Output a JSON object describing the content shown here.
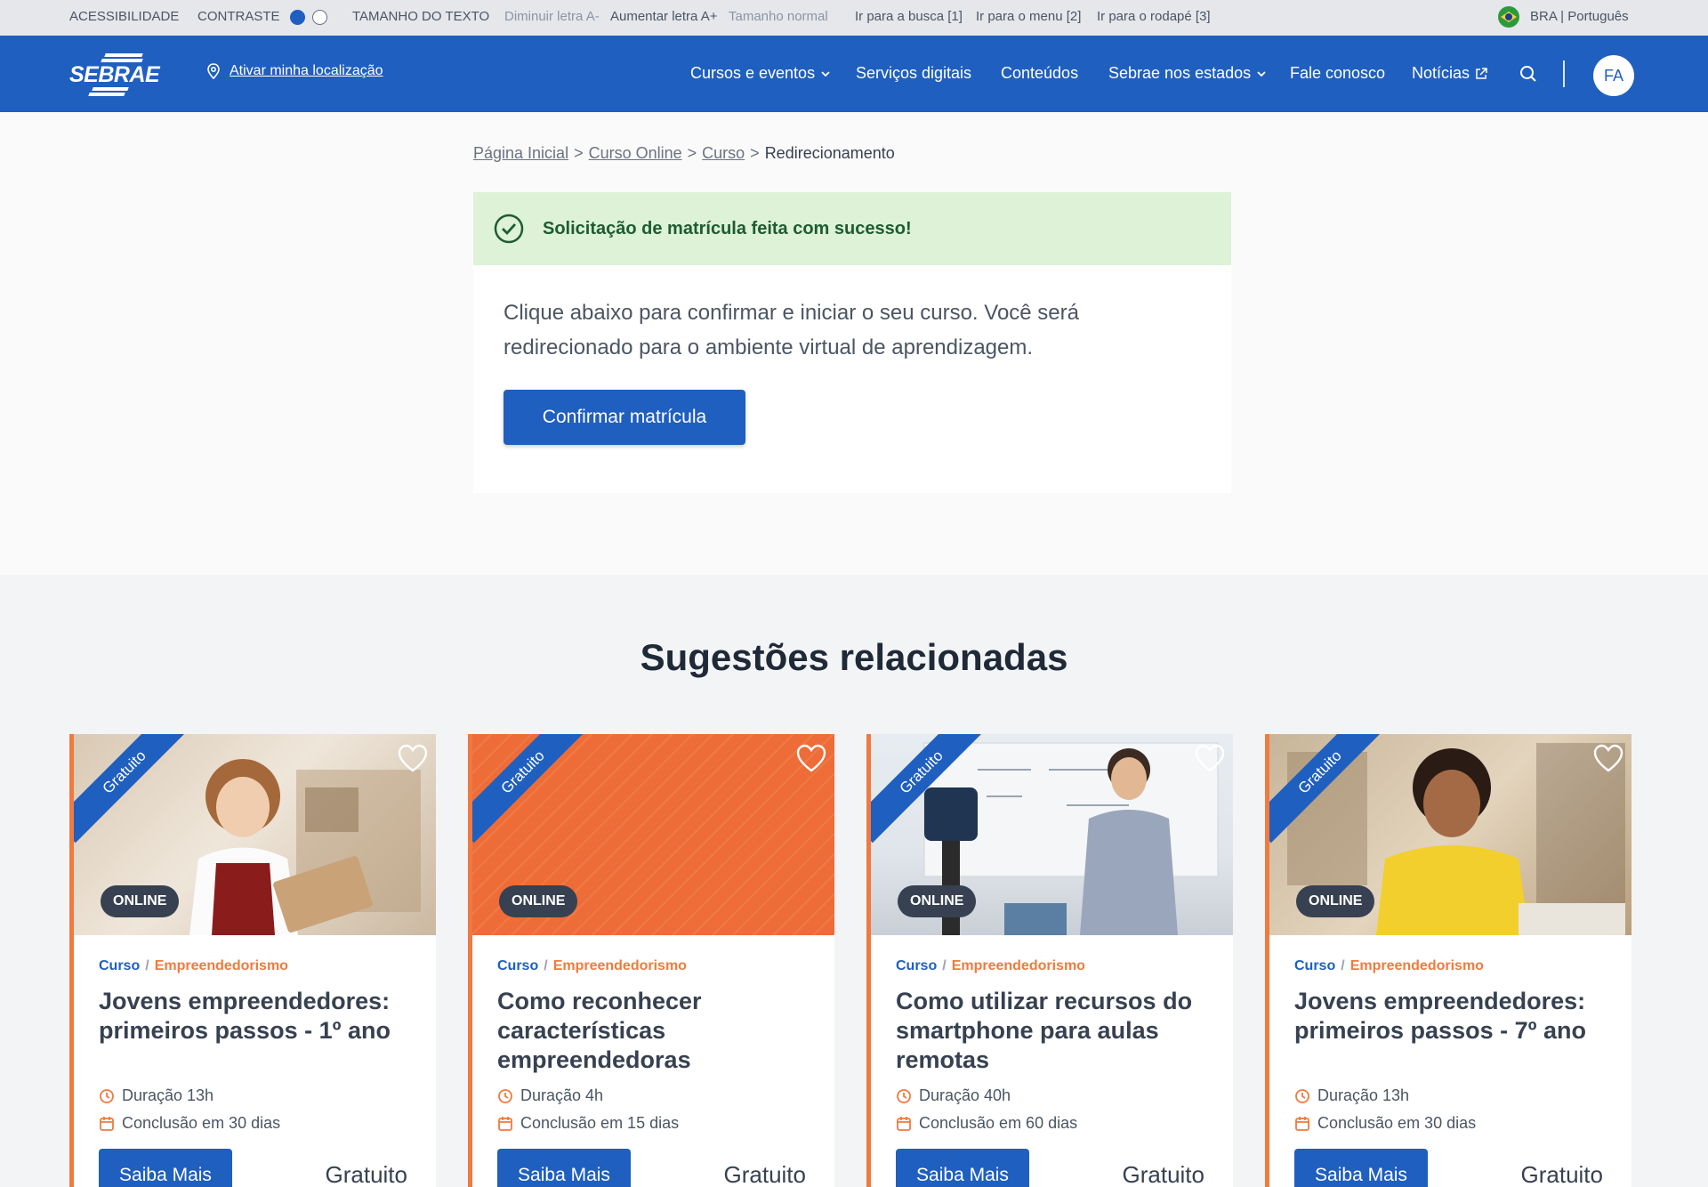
{
  "a11y": {
    "accessibility": "ACESSIBILIDADE",
    "contrast": "CONTRASTE",
    "text_size": "TAMANHO DO TEXTO",
    "decrease": "Diminuir letra A-",
    "increase": "Aumentar letra A+",
    "normal": "Tamanho normal",
    "goto_search": "Ir para a busca [1]",
    "goto_menu": "Ir para o menu [2]",
    "goto_footer": "Ir para o rodapé [3]",
    "language": "BRA | Português"
  },
  "header": {
    "logo": "SEBRAE",
    "location_link": "Ativar minha localização",
    "nav": [
      "Cursos e eventos",
      "Serviços digitais",
      "Conteúdos",
      "Sebrae nos estados",
      "Fale conosco",
      "Notícias"
    ],
    "avatar_initials": "FA"
  },
  "breadcrumb": {
    "items": [
      "Página Inicial",
      "Curso Online",
      "Curso"
    ],
    "current": "Redirecionamento"
  },
  "enrollment": {
    "success_message": "Solicitação de matrícula feita com sucesso!",
    "body_text": "Clique abaixo para confirmar e iniciar o seu curso. Você será redirecionado para o ambiente virtual de aprendizagem.",
    "confirm_label": "Confirmar matrícula"
  },
  "suggestions": {
    "title": "Sugestões relacionadas",
    "cards": [
      {
        "ribbon": "Gratuito",
        "badge": "ONLINE",
        "type": "Curso",
        "category": "Empreendedorismo",
        "title": "Jovens empreendedores: primeiros passos - 1º ano",
        "duration": "Duração 13h",
        "completion": "Conclusão em 30 dias",
        "cta": "Saiba Mais",
        "price": "Gratuito"
      },
      {
        "ribbon": "Gratuito",
        "badge": "ONLINE",
        "type": "Curso",
        "category": "Empreendedorismo",
        "title": "Como reconhecer características empreendedoras",
        "duration": "Duração 4h",
        "completion": "Conclusão em 15 dias",
        "cta": "Saiba Mais",
        "price": "Gratuito"
      },
      {
        "ribbon": "Gratuito",
        "badge": "ONLINE",
        "type": "Curso",
        "category": "Empreendedorismo",
        "title": "Como utilizar recursos do smartphone para aulas remotas",
        "duration": "Duração 40h",
        "completion": "Conclusão em 60 dias",
        "cta": "Saiba Mais",
        "price": "Gratuito"
      },
      {
        "ribbon": "Gratuito",
        "badge": "ONLINE",
        "type": "Curso",
        "category": "Empreendedorismo",
        "title": "Jovens empreendedores: primeiros passos - 7º ano",
        "duration": "Duração 13h",
        "completion": "Conclusão em 30 dias",
        "cta": "Saiba Mais",
        "price": "Gratuito"
      }
    ]
  },
  "colors": {
    "primary": "#1f5fbf",
    "accent": "#f07a3f",
    "success_bg": "#ddf2d7",
    "success_text": "#1f5b34"
  }
}
